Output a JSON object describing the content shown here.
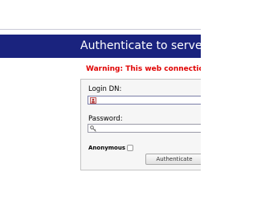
{
  "header": {
    "title": "Authenticate to server My"
  },
  "warning": {
    "text": "Warning: This web connection i"
  },
  "form": {
    "login_dn_label": "Login DN:",
    "login_dn_value": "",
    "password_label": "Password:",
    "password_value": "",
    "anonymous_label": "Anonymous",
    "anonymous_checked": false,
    "submit_label": "Authenticate"
  },
  "icons": {
    "login_dn_field": "user-icon",
    "password_field": "key-icon"
  },
  "colors": {
    "header_background": "#1a237e",
    "header_text": "#ffffff",
    "warning_text": "#e00000",
    "form_background": "#f6f6f6"
  }
}
